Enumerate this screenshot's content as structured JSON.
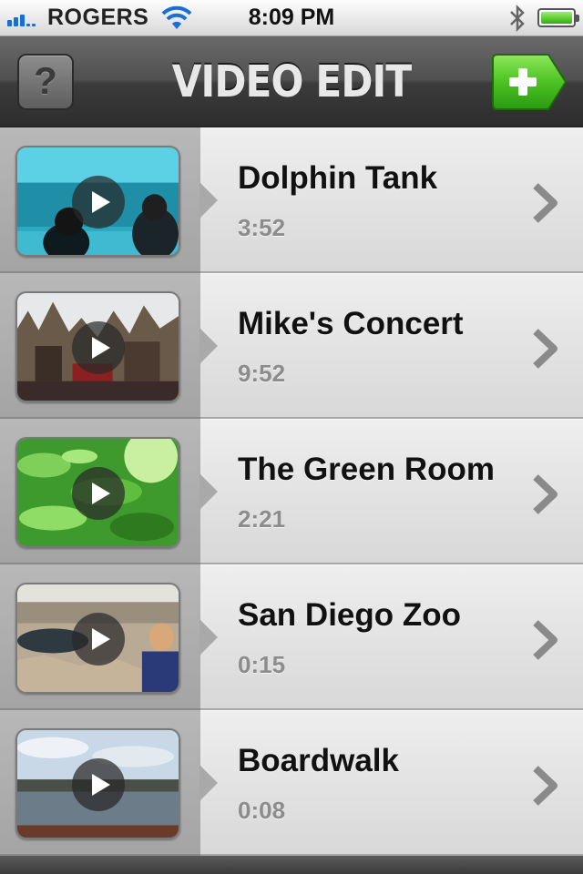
{
  "status_bar": {
    "carrier": "ROGERS",
    "time": "8:09 PM",
    "signal_bars": 3,
    "signal_bars_total": 5,
    "battery_level": 1.0,
    "icons": [
      "signal-icon",
      "wifi-icon",
      "bluetooth-icon",
      "battery-icon"
    ]
  },
  "navbar": {
    "title": "VIDEO EDIT",
    "help_label": "?",
    "help_icon": "help-icon",
    "add_icon": "plus-icon",
    "accent_green": "#3cb81a"
  },
  "videos": [
    {
      "title": "Dolphin Tank",
      "duration": "3:52",
      "thumbnail": "aquarium-scene"
    },
    {
      "title": "Mike's Concert",
      "duration": "9:52",
      "thumbnail": "castle-village-scene"
    },
    {
      "title": "The Green Room",
      "duration": "2:21",
      "thumbnail": "green-foliage-scene"
    },
    {
      "title": "San Diego Zoo",
      "duration": "0:15",
      "thumbnail": "zoo-rocks-scene"
    },
    {
      "title": "Boardwalk",
      "duration": "0:08",
      "thumbnail": "waterfront-scene"
    }
  ]
}
